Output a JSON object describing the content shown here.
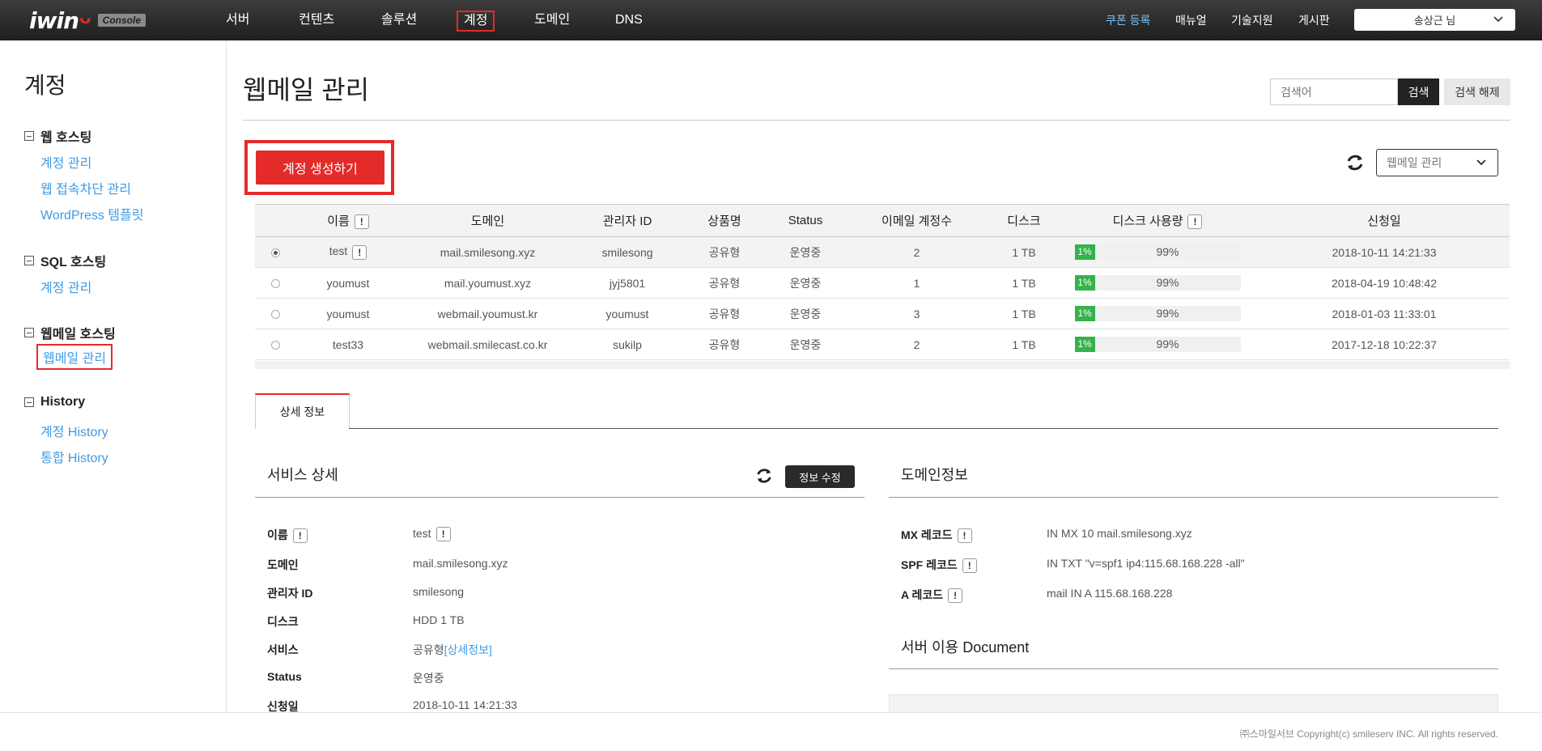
{
  "brand": {
    "logo_text": "iwin",
    "logo_mark": "ᴗ",
    "console_label": "Console"
  },
  "topnav": {
    "items": [
      {
        "label": "서버"
      },
      {
        "label": "컨텐츠"
      },
      {
        "label": "솔루션"
      },
      {
        "label": "계정",
        "active": true
      },
      {
        "label": "도메인"
      },
      {
        "label": "DNS"
      }
    ],
    "right_links": [
      "쿠폰 등록",
      "매뉴얼",
      "기술지원",
      "게시판"
    ],
    "user_label": "송상근 님"
  },
  "sidebar": {
    "title": "계정",
    "groups": [
      {
        "label": "웹 호스팅",
        "links": [
          "계정 관리",
          "웹 접속차단 관리",
          "WordPress 템플릿"
        ]
      },
      {
        "label": "SQL 호스팅",
        "links": [
          "계정 관리"
        ]
      },
      {
        "label": "웹메일 호스팅",
        "links": [
          "웹메일 관리"
        ]
      },
      {
        "label": "History",
        "links": [
          "계정 History",
          "통합 History"
        ]
      }
    ]
  },
  "page": {
    "title": "웹메일 관리",
    "search_placeholder": "검색어",
    "search_button": "검색",
    "clear_button": "검색 해제",
    "create_button": "계정 생성하기",
    "type_select": "웹메일 관리"
  },
  "table": {
    "headers": [
      "이름",
      "도메인",
      "관리자 ID",
      "상품명",
      "Status",
      "이메일 계정수",
      "디스크",
      "디스크 사용량",
      "신청일"
    ],
    "info_mark": "!",
    "rows": [
      {
        "name": "test",
        "domain": "mail.smilesong.xyz",
        "admin": "smilesong",
        "product": "공유형",
        "status": "운영중",
        "accounts": "2",
        "disk": "1 TB",
        "used": "1%",
        "free": "99%",
        "used_fraction": 0.01,
        "date": "2018-10-11 14:21:33",
        "selected": true
      },
      {
        "name": "youmust",
        "domain": "mail.youmust.xyz",
        "admin": "jyj5801",
        "product": "공유형",
        "status": "운영중",
        "accounts": "1",
        "disk": "1 TB",
        "used": "1%",
        "free": "99%",
        "used_fraction": 0.01,
        "date": "2018-04-19 10:48:42"
      },
      {
        "name": "youmust",
        "domain": "webmail.youmust.kr",
        "admin": "youmust",
        "product": "공유형",
        "status": "운영중",
        "accounts": "3",
        "disk": "1 TB",
        "used": "1%",
        "free": "99%",
        "used_fraction": 0.01,
        "date": "2018-01-03 11:33:01"
      },
      {
        "name": "test33",
        "domain": "webmail.smilecast.co.kr",
        "admin": "sukilp",
        "product": "공유형",
        "status": "운영중",
        "accounts": "2",
        "disk": "1 TB",
        "used": "1%",
        "free": "99%",
        "used_fraction": 0.01,
        "date": "2017-12-18 10:22:37"
      }
    ]
  },
  "detail": {
    "tab_label": "상세 정보",
    "service_title": "서비스 상세",
    "edit_button": "정보 수정",
    "service_fields": [
      {
        "label": "이름",
        "value": "test",
        "info": true
      },
      {
        "label": "도메인",
        "value": "mail.smilesong.xyz"
      },
      {
        "label": "관리자 ID",
        "value": "smilesong"
      },
      {
        "label": "디스크",
        "value": "HDD 1 TB"
      },
      {
        "label": "서비스",
        "value": "공유형",
        "link": "[상세정보]"
      },
      {
        "label": "Status",
        "value": "운영중"
      },
      {
        "label": "신청일",
        "value": "2018-10-11 14:21:33"
      }
    ],
    "domain_title": "도메인정보",
    "domain_fields": [
      {
        "label": "MX 레코드",
        "value": "IN MX 10 mail.smilesong.xyz"
      },
      {
        "label": "SPF 레코드",
        "value": "IN TXT \"v=spf1 ip4:115.68.168.228 -all\""
      },
      {
        "label": "A 레코드",
        "value": "mail IN A 115.68.168.228"
      }
    ],
    "doc_title": "서버 이용 Document"
  },
  "footer": {
    "text": "㈜스마일서브 Copyright(c) smileserv INC. All rights reserved."
  },
  "colors": {
    "accent": "#e52a2a",
    "link": "#3f9ae5",
    "usage": "#34b24b",
    "topbar": "#2a2a2a"
  }
}
